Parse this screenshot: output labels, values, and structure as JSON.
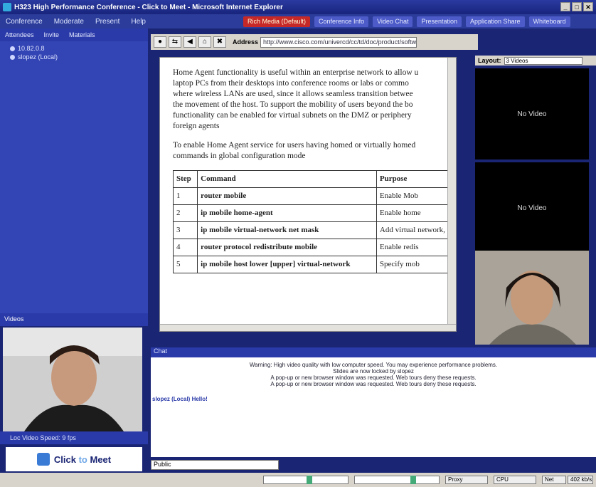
{
  "window": {
    "title": "H323 High Performance Conference - Click to Meet - Microsoft Internet Explorer",
    "controls": [
      "_",
      "□",
      "✕"
    ]
  },
  "menu": [
    "Conference",
    "Moderate",
    "Present",
    "Help"
  ],
  "tabs": [
    "Rich Media (Default)",
    "Conference Info",
    "Video Chat",
    "Presentation",
    "Application Share",
    "Whiteboard"
  ],
  "left": {
    "subtabs": [
      "Attendees",
      "Invite",
      "Materials"
    ],
    "attendees": [
      "10.82.0.8",
      "slopez (Local)"
    ],
    "videos_label": "Videos",
    "speed_label": "Loc Video Speed: 9 fps"
  },
  "logo": {
    "text_a": "Click",
    "text_b": "to",
    "text_c": "Meet"
  },
  "toolbar": {
    "address_label": "Address",
    "address_value": "http://www.cisco.com/univercd/cc/td/doc/product/software"
  },
  "doc": {
    "para1": [
      "Home Agent functionality is useful within an enterprise network to allow u",
      "laptop PCs from their desktops into conference rooms or labs or commo",
      "where wireless LANs are used, since it allows seamless transition betwee",
      "the movement of the host. To support the mobility of users beyond the bo",
      "functionality can be enabled for virtual subnets on the DMZ or periphery",
      "foreign agents"
    ],
    "para2": [
      "To enable Home Agent service for users having homed or virtually homed",
      "commands in global configuration mode"
    ],
    "table": {
      "headers": [
        "Step",
        "Command",
        "Purpose"
      ],
      "rows": [
        {
          "step": "1",
          "cmd": "router mobile",
          "purpose": "Enable Mob"
        },
        {
          "step": "2",
          "cmd": "ip mobile home-agent",
          "purpose": "Enable home"
        },
        {
          "step": "3",
          "cmd": "ip mobile virtual-network net mask",
          "purpose": "Add virtual network, sta"
        },
        {
          "step": "4",
          "cmd": "router protocol redistribute mobile",
          "purpose": "Enable redis"
        },
        {
          "step": "5",
          "cmd": "ip mobile host lower [upper] virtual-network",
          "purpose": "Specify mob"
        }
      ]
    }
  },
  "right": {
    "layout_label": "Layout:",
    "layout_value": "3 Videos",
    "no_video": "No Video"
  },
  "chat": {
    "header": "Chat",
    "lines": [
      "Warning: High video quality with low computer speed. You may experience performance problems.",
      "Slides are now locked by slopez",
      "A pop-up or new browser window was requested. Web tours deny these requests.",
      "A pop-up or new browser window was requested. Web tours deny these requests."
    ],
    "user_prefix": "slopez (Local) Hello!",
    "input_value": "Public"
  },
  "status": {
    "s1": "0",
    "s2": "4E",
    "proxy": "Proxy",
    "cpu": "CPU",
    "net": "Net",
    "rate": "402 kb/s"
  },
  "colors": {
    "frame": "#1a2574",
    "panel": "#3344b4",
    "active_tab": "#c62828"
  }
}
